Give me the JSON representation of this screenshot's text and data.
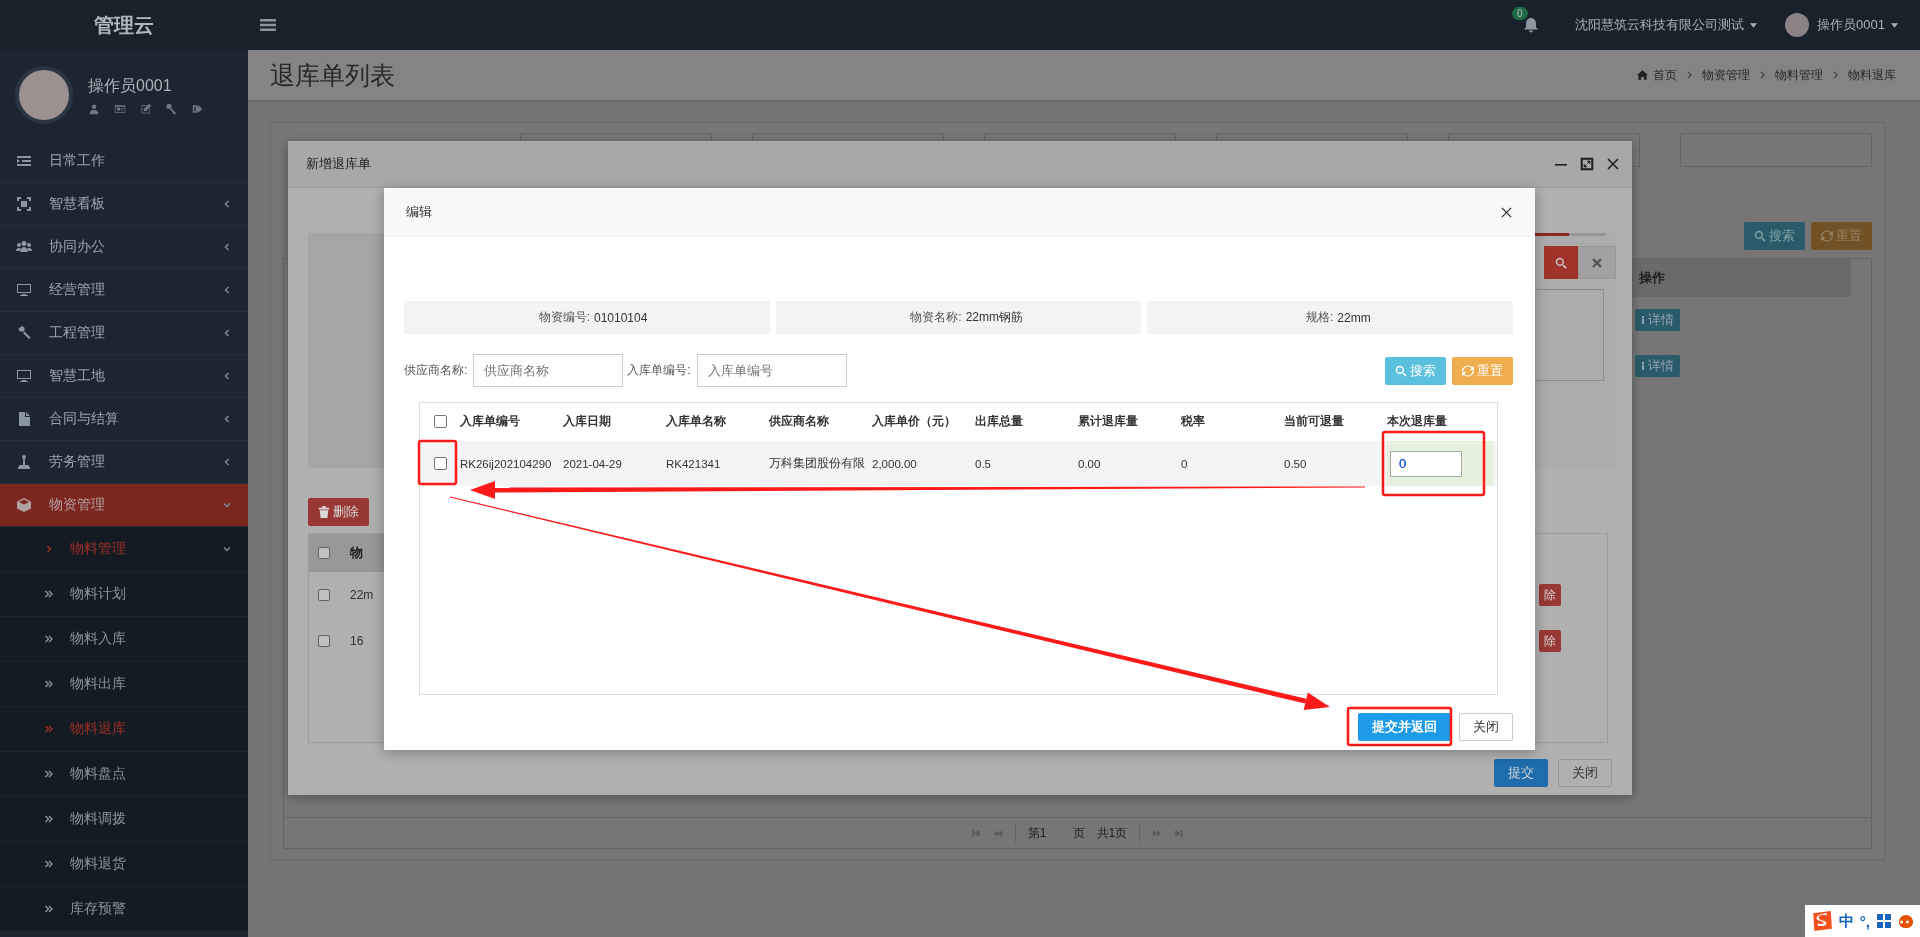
{
  "brand": {
    "logo": "管理云"
  },
  "header": {
    "notification_count": "0",
    "company": "沈阳慧筑云科技有限公司测试",
    "user": "操作员0001"
  },
  "sidebar": {
    "user": "操作员0001",
    "menu": [
      {
        "label": "日常工作",
        "expandable": false,
        "selected": false
      },
      {
        "label": "智慧看板",
        "expandable": true,
        "expanded": false,
        "selected": false
      },
      {
        "label": "协同办公",
        "expandable": true,
        "expanded": false,
        "selected": false
      },
      {
        "label": "经营管理",
        "expandable": true,
        "expanded": false,
        "selected": false
      },
      {
        "label": "工程管理",
        "expandable": true,
        "expanded": false,
        "selected": false
      },
      {
        "label": "智慧工地",
        "expandable": true,
        "expanded": false,
        "selected": false
      },
      {
        "label": "合同与结算",
        "expandable": true,
        "expanded": false,
        "selected": false
      },
      {
        "label": "劳务管理",
        "expandable": true,
        "expanded": false,
        "selected": false
      },
      {
        "label": "物资管理",
        "expandable": true,
        "expanded": true,
        "selected": true,
        "children": [
          {
            "label": "物料管理",
            "expandable": true,
            "expanded": true,
            "selected": true,
            "children": [
              {
                "label": "物料计划",
                "selected": false
              },
              {
                "label": "物料入库",
                "selected": false
              },
              {
                "label": "物料出库",
                "selected": false
              },
              {
                "label": "物料退库",
                "selected": true
              },
              {
                "label": "物料盘点",
                "selected": false
              },
              {
                "label": "物料调拨",
                "selected": false
              },
              {
                "label": "物料退货",
                "selected": false
              },
              {
                "label": "库存预警",
                "selected": false
              }
            ]
          }
        ]
      }
    ]
  },
  "page": {
    "title": "退库单列表",
    "breadcrumb": [
      "首页",
      "物资管理",
      "物料管理",
      "物料退库"
    ],
    "search_buttons": [
      "搜索",
      "重置"
    ],
    "table": {
      "columns": [
        "操作"
      ],
      "rows": [
        {
          "action": "详情"
        },
        {
          "action": "详情"
        }
      ]
    },
    "pagination": {
      "current": "第1",
      "page_unit": "页",
      "total": "共1页"
    }
  },
  "outer_dialog": {
    "title": "新增退库单",
    "delete_button": "删除",
    "list": {
      "all_selected": false,
      "columns": [
        "物"
      ],
      "rows": [
        {
          "cell": "22m",
          "action": "除",
          "selected": false
        },
        {
          "cell": "16",
          "action": "除",
          "selected": false
        }
      ]
    },
    "buttons": [
      "提交",
      "关闭"
    ]
  },
  "dialog": {
    "title": "编辑",
    "info": [
      {
        "label": "物资编号:",
        "value": "01010104"
      },
      {
        "label": "物资名称:",
        "value": "22mm钢筋"
      },
      {
        "label": "规格:",
        "value": "22mm"
      }
    ],
    "filters": [
      {
        "label": "供应商名称:",
        "placeholder": "供应商名称"
      },
      {
        "label": "入库单编号:",
        "placeholder": "入库单编号"
      }
    ],
    "buttons": [
      "搜索",
      "重置"
    ],
    "table": {
      "all_selected": false,
      "columns": [
        "入库单编号",
        "入库日期",
        "入库单名称",
        "供应商名称",
        "入库单价（元）",
        "出库总量",
        "累计退库量",
        "税率",
        "当前可退量",
        "本次退库量"
      ],
      "rows": [
        {
          "selected": false,
          "cells": [
            "RK26ij202104290",
            "2021-04-29",
            "RK421341",
            "万科集团股份有限",
            "2,000.00",
            "0.5",
            "0.00",
            "0",
            "0.50"
          ],
          "return_quantity": "0"
        }
      ]
    },
    "footer_buttons": [
      "提交并返回",
      "关闭"
    ]
  },
  "ime_bar": {
    "mode": "中",
    "punctuation": "°,"
  }
}
